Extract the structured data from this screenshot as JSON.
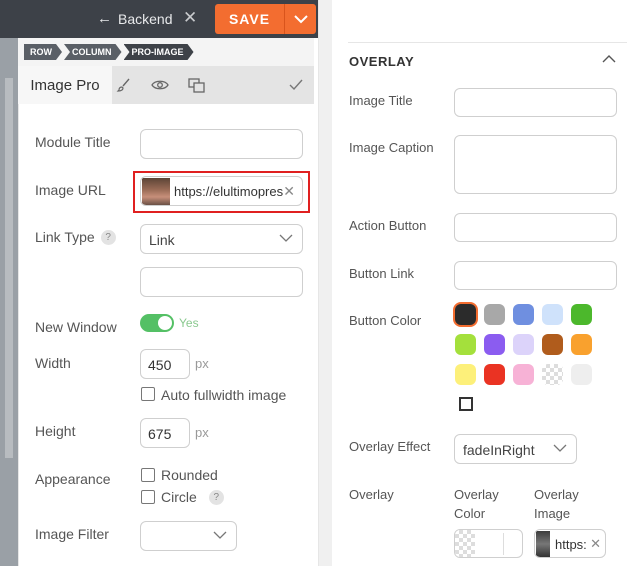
{
  "header": {
    "back_label": "Backend",
    "save_label": "SAVE"
  },
  "breadcrumb": [
    "ROW",
    "COLUMN",
    "PRO-IMAGE"
  ],
  "tabs": {
    "active_label": "Image Pro"
  },
  "form": {
    "module_title": {
      "label": "Module Title",
      "value": ""
    },
    "image_url": {
      "label": "Image URL",
      "value": "https://elultimopres"
    },
    "link_type": {
      "label": "Link Type",
      "help": "?",
      "selected": "Link",
      "link_value": ""
    },
    "new_window": {
      "label": "New Window",
      "state": "Yes",
      "on": true
    },
    "width": {
      "label": "Width",
      "value": "450",
      "unit": "px",
      "auto_fullwidth_label": "Auto fullwidth image"
    },
    "height": {
      "label": "Height",
      "value": "675",
      "unit": "px"
    },
    "appearance": {
      "label": "Appearance",
      "rounded_label": "Rounded",
      "circle_label": "Circle",
      "help": "?"
    },
    "image_filter": {
      "label": "Image Filter",
      "selected": ""
    }
  },
  "overlay": {
    "section_title": "OVERLAY",
    "image_title": {
      "label": "Image Title",
      "value": ""
    },
    "image_caption": {
      "label": "Image Caption",
      "value": ""
    },
    "action_button": {
      "label": "Action Button",
      "value": ""
    },
    "button_link": {
      "label": "Button Link",
      "value": ""
    },
    "button_color": {
      "label": "Button Color",
      "swatches": [
        "#2b2b2b",
        "#a8a8a8",
        "#6f8fe0",
        "#cfe2fb",
        "#4cb82c",
        "#a4e03c",
        "#8b5cf0",
        "#dcd3fa",
        "#b05c1c",
        "#f9a12e",
        "#fdf07a",
        "#ea3323",
        "#f7b2d6",
        "transparent",
        "#eeeeee"
      ],
      "selected_index": 0
    },
    "overlay_effect": {
      "label": "Overlay Effect",
      "selected": "fadeInRight"
    },
    "overlay": {
      "label": "Overlay",
      "color_label": "Overlay Color",
      "image_label": "Overlay Image",
      "image_value": "https:"
    }
  },
  "colors": {
    "accent": "#f36d30",
    "toolbar": "#3d4148",
    "toggle_on": "#54c065",
    "highlight": "#e02020"
  }
}
